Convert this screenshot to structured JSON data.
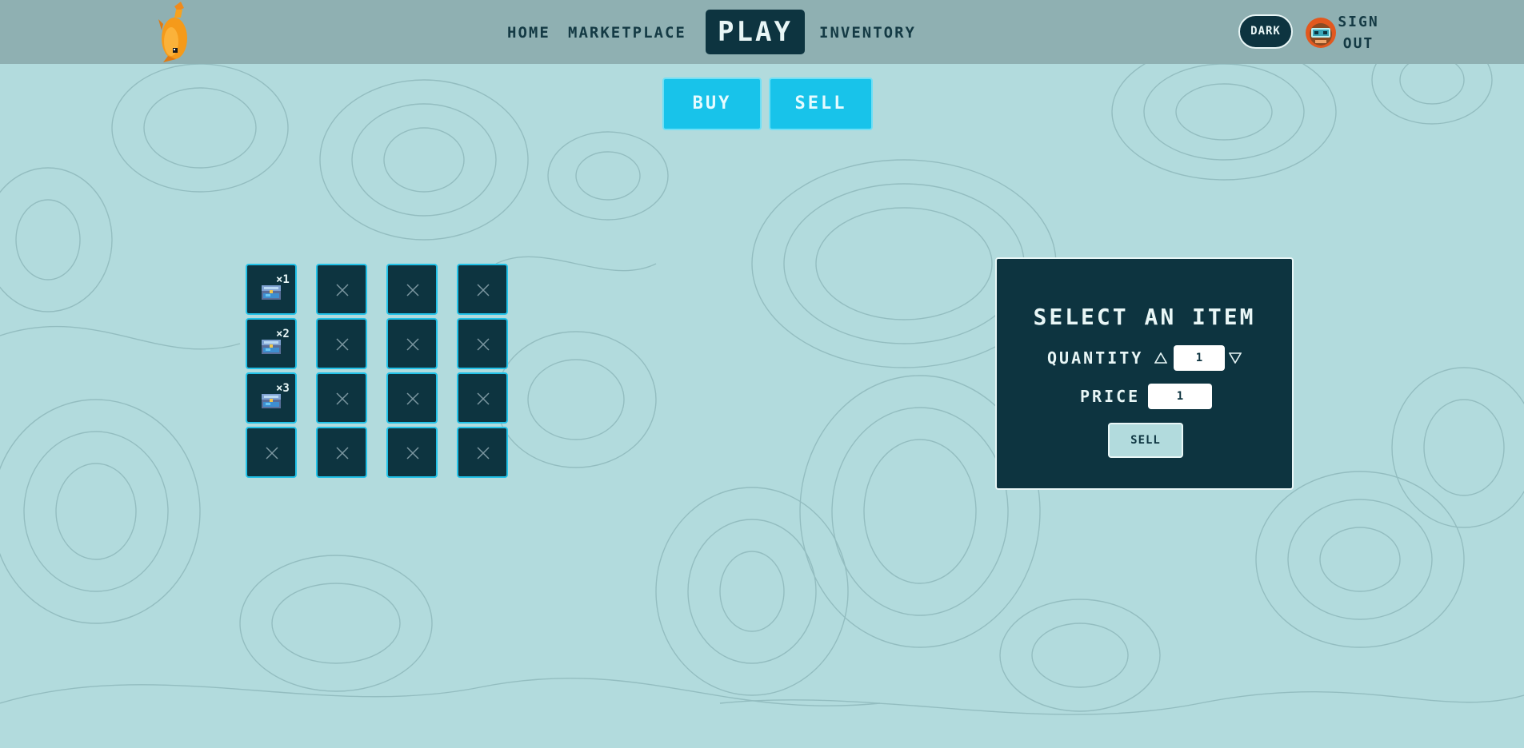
{
  "nav": {
    "home": "HOME",
    "marketplace": "MARKETPLACE",
    "play": "PLAY",
    "inventory": "INVENTORY",
    "dark_toggle": "DARK",
    "sign_out_line1": "SIGN",
    "sign_out_line2": "OUT",
    "logo_icon": "goldfish-logo-icon",
    "avatar_icon": "player-avatar-icon"
  },
  "tabs": {
    "buy": "BUY",
    "sell": "SELL"
  },
  "inventory": {
    "items": [
      {
        "icon": "treasure-chest-icon",
        "quantity": "×1"
      },
      {
        "icon": "treasure-chest-icon",
        "quantity": "×2"
      },
      {
        "icon": "treasure-chest-icon",
        "quantity": "×3"
      }
    ],
    "empty_slot_icon": "close-icon"
  },
  "sell_panel": {
    "title": "SELECT AN ITEM",
    "quantity_label": "QUANTITY",
    "quantity_value": "1",
    "price_label": "PRICE",
    "price_value": "1",
    "submit_label": "SELL"
  },
  "colors": {
    "background": "#b2dbdd",
    "navbar": "#8fb0b2",
    "dark_navy": "#0d3440",
    "accent_cyan": "#18c3ea",
    "slot_border": "#22c2e8"
  }
}
